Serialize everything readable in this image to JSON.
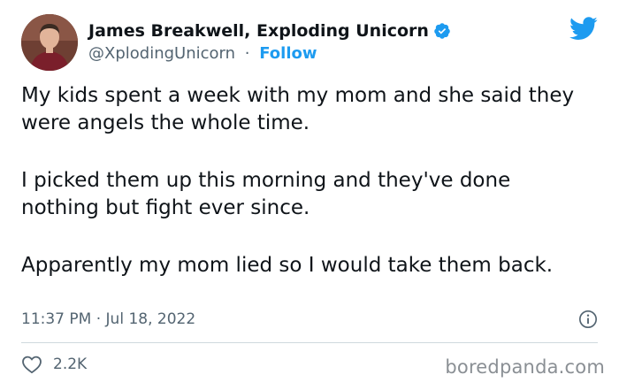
{
  "author": {
    "display_name": "James Breakwell, Exploding Unicorn",
    "handle": "@XplodingUnicorn",
    "separator": "·",
    "follow_label": "Follow",
    "verified": true
  },
  "tweet": {
    "paragraphs": [
      "My kids spent a week with my mom and she said they were angels the whole time.",
      "I picked them up this morning and they've done nothing but fight ever since.",
      "Apparently my mom lied so I would take them back."
    ],
    "timestamp": "11:37 PM · Jul 18, 2022",
    "like_count": "2.2K"
  },
  "watermark": "boredpanda.com",
  "icons": {
    "brand": "twitter-bird-icon",
    "verified": "verified-badge-icon",
    "info": "info-icon",
    "like": "heart-icon"
  },
  "colors": {
    "accent": "#1d9bf0",
    "text": "#0f1419",
    "secondary": "#536471",
    "divider": "#cfd9de"
  }
}
